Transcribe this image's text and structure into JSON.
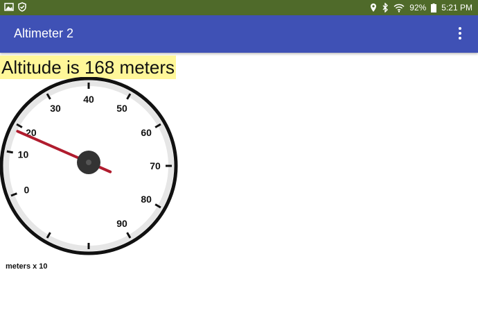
{
  "status_bar": {
    "left_icons": [
      "image-icon",
      "shield-check-icon"
    ],
    "right_icons": [
      "location-pin-icon",
      "bluetooth-icon",
      "wifi-icon"
    ],
    "battery_percent": "92%",
    "time": "5:21 PM"
  },
  "app_bar": {
    "title": "Altimeter 2",
    "menu_icon": "more-vert-icon"
  },
  "altitude_text": "Altitude is 168 meters",
  "gauge": {
    "dial_labels": [
      "0",
      "10",
      "20",
      "30",
      "40",
      "50",
      "60",
      "70",
      "80",
      "90"
    ],
    "needle_value": 16.8,
    "units_label": "meters x 10"
  },
  "colors": {
    "status_bar": "#4f6a2a",
    "app_bar": "#3f51b5",
    "altitude_highlight": "#fff799",
    "needle": "#b01c2e",
    "hub": "#333333"
  }
}
